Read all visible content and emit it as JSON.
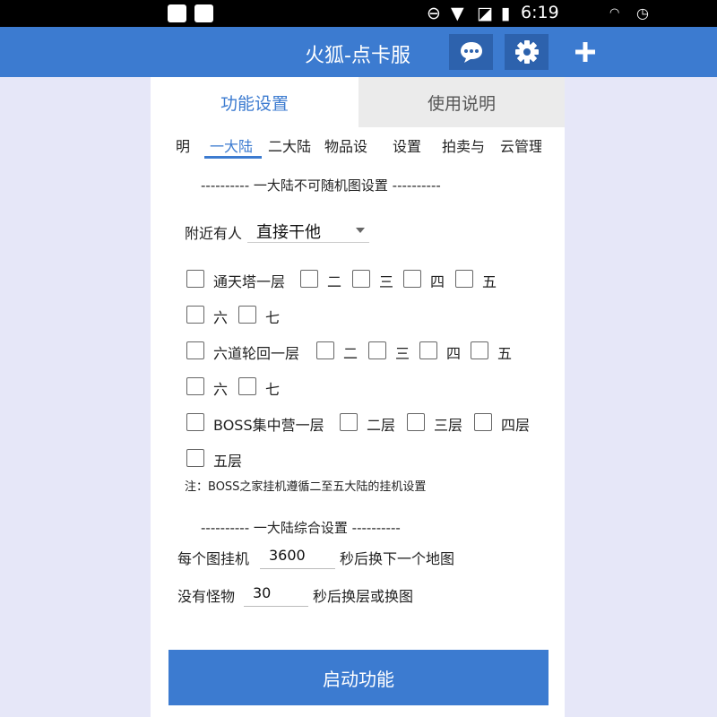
{
  "status_bar": {
    "time": "6:19"
  },
  "app_bar": {
    "title": "火狐-点卡服",
    "icons": [
      "chat-icon",
      "gear-icon",
      "plus-icon"
    ]
  },
  "main_tabs": [
    {
      "label": "功能设置",
      "active": true
    },
    {
      "label": "使用说明",
      "active": false
    }
  ],
  "sub_tabs": [
    {
      "label": "明"
    },
    {
      "label": "一大陆",
      "active": true
    },
    {
      "label": "二大陆"
    },
    {
      "label": "物品设"
    },
    {
      "label": "设置"
    },
    {
      "label": "拍卖与"
    },
    {
      "label": "云管理"
    }
  ],
  "section1": {
    "title": "---------- 一大陆不可随机图设置 ----------",
    "nearby_label": "附近有人",
    "nearby_value": "直接干他",
    "rows": {
      "tower": [
        "通天塔一层",
        "二",
        "三",
        "四",
        "五",
        "六",
        "七"
      ],
      "samsara": [
        "六道轮回一层",
        "二",
        "三",
        "四",
        "五",
        "六",
        "七"
      ],
      "boss": [
        "BOSS集中营一层",
        "二层",
        "三层",
        "四层",
        "五层"
      ]
    },
    "note": "注：BOSS之家挂机遵循二至五大陆的挂机设置"
  },
  "section2": {
    "title": "---------- 一大陆综合设置 ----------",
    "map_label": "每个图挂机",
    "map_value": "3600",
    "map_suffix": "秒后换下一个地图",
    "nomonster_label": "没有怪物",
    "nomonster_value": "30",
    "nomonster_suffix": "秒后换层或换图"
  },
  "start_button": "启动功能",
  "colors": {
    "primary": "#3c7bd0",
    "primary_dark": "#2d62ad",
    "background": "#e6e7f8"
  }
}
